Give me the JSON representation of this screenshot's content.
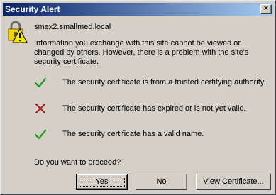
{
  "window": {
    "title": "Security Alert",
    "close_label": "×"
  },
  "dialog": {
    "host": "smex2.smallmed.local",
    "info": "Information you exchange with this site cannot be viewed or changed by others. However, there is a problem with the site's security certificate.",
    "checks": [
      {
        "status": "ok",
        "text": "The security certificate is from a trusted certifying authority."
      },
      {
        "status": "fail",
        "text": "The security certificate has expired or is not yet valid."
      },
      {
        "status": "ok",
        "text": "The security certificate has a valid name."
      }
    ],
    "question": "Do you want to proceed?"
  },
  "buttons": {
    "yes": "Yes",
    "no": "No",
    "view": "View Certificate..."
  },
  "colors": {
    "ok": "#1e9a1e",
    "fail": "#a52020",
    "title_start": "#0a246a",
    "title_end": "#a6caf0"
  },
  "icons": {
    "lock": "padlock-warning-icon",
    "ok": "check-icon",
    "fail": "x-mark-icon"
  }
}
